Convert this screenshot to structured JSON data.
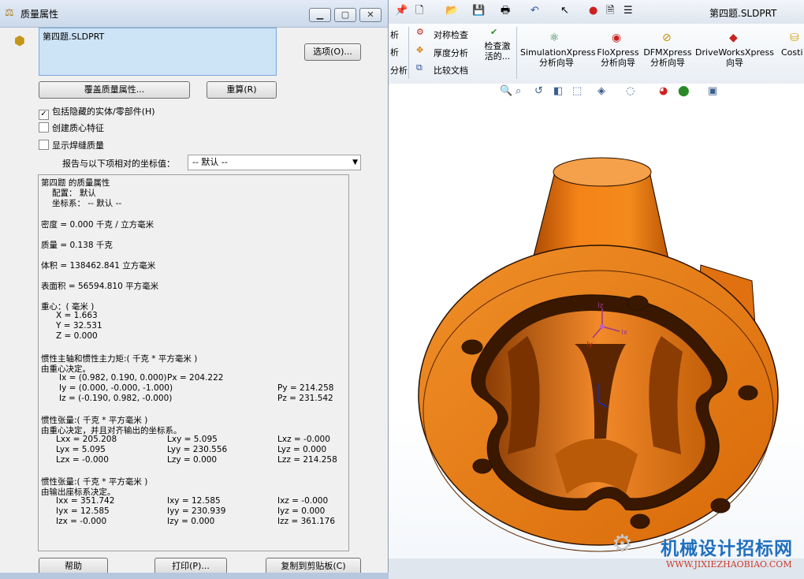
{
  "dialog": {
    "title": "质量属性",
    "parts_list_item": "第四题.SLDPRT",
    "options_button": "选项(O)...",
    "override_button": "覆盖质量属性...",
    "recalc_button": "重算(R)",
    "include_hidden": {
      "label": "包括隐藏的实体/零部件(H)",
      "checked": true
    },
    "create_com": {
      "label": "创建质心特征",
      "checked": false
    },
    "show_weld": {
      "label": "显示焊缝质量",
      "checked": false
    },
    "report_coord_label": "报告与以下项相对的坐标值：",
    "coord_select_value": "-- 默认 --",
    "help_button": "帮助",
    "print_button": "打印(P)...",
    "copy_button": "复制到剪贴板(C)"
  },
  "results": {
    "header": "第四题 的质量属性",
    "config": "配置： 默认",
    "coordsys": "坐标系： -- 默认 --",
    "density": "密度 = 0.000 千克 / 立方毫米",
    "mass": "质量 = 0.138 千克",
    "volume": "体积 = 138462.841 立方毫米",
    "surface_area": "表面积 = 56594.810  平方毫米",
    "com_title": "重心：( 毫米 )",
    "com_x": "X = 1.663",
    "com_y": "Y = 32.531",
    "com_z": "Z = 0.000",
    "principal_title": "惯性主轴和惯性主力矩:( 千克 *  平方毫米 )",
    "principal_sub": "由重心决定。",
    "ix": "Ix = (0.982, 0.190, 0.000)",
    "px": "Px = 204.222",
    "iy": "Iy = (0.000, -0.000, -1.000)",
    "py": "Py = 214.258",
    "iz": "Iz = (-0.190, 0.982, -0.000)",
    "pz": "Pz = 231.542",
    "tensor1_title": "惯性张量:( 千克 *  平方毫米 )",
    "tensor1_sub": "由重心决定，并且对齐输出的坐标系。",
    "t1": [
      [
        "Lxx = 205.208",
        "Lxy = 5.095",
        "Lxz = -0.000"
      ],
      [
        "Lyx = 5.095",
        "Lyy = 230.556",
        "Lyz = 0.000"
      ],
      [
        "Lzx = -0.000",
        "Lzy = 0.000",
        "Lzz = 214.258"
      ]
    ],
    "tensor2_title": "惯性张量:( 千克 *  平方毫米 )",
    "tensor2_sub": "由输出座标系决定。",
    "t2": [
      [
        "Ixx = 351.742",
        "Ixy = 12.585",
        "Ixz = -0.000"
      ],
      [
        "Iyx = 12.585",
        "Iyy = 230.939",
        "Iyz = 0.000"
      ],
      [
        "Izx = -0.000",
        "Izy = 0.000",
        "Izz = 361.176"
      ]
    ]
  },
  "toolbar": {
    "doc_title": "第四题.SLDPRT",
    "sym_check": "对称检查",
    "thickness": "厚度分析",
    "compare": "比较文档",
    "check_active": "检查激活的...",
    "simulation": "SimulationXpress\n分析向导",
    "flo": "FloXpress\n分析向导",
    "dfm": "DFMXpress\n分析向导",
    "driveworks": "DriveWorksXpress\n向导",
    "costing": "Costi",
    "left_clip_1": "析",
    "left_clip_2": "析",
    "left_clip_3": "分析"
  },
  "triad": {
    "iz": "Iz",
    "ix": "Ix",
    "iy": "Iy"
  },
  "watermark": {
    "title": "机械设计招标网",
    "url": "WWW.JIXIEZHAOBIAO.COM"
  },
  "colors": {
    "part": "#f08010",
    "part_dark": "#8a3a00",
    "accent": "#1f6fbf"
  }
}
